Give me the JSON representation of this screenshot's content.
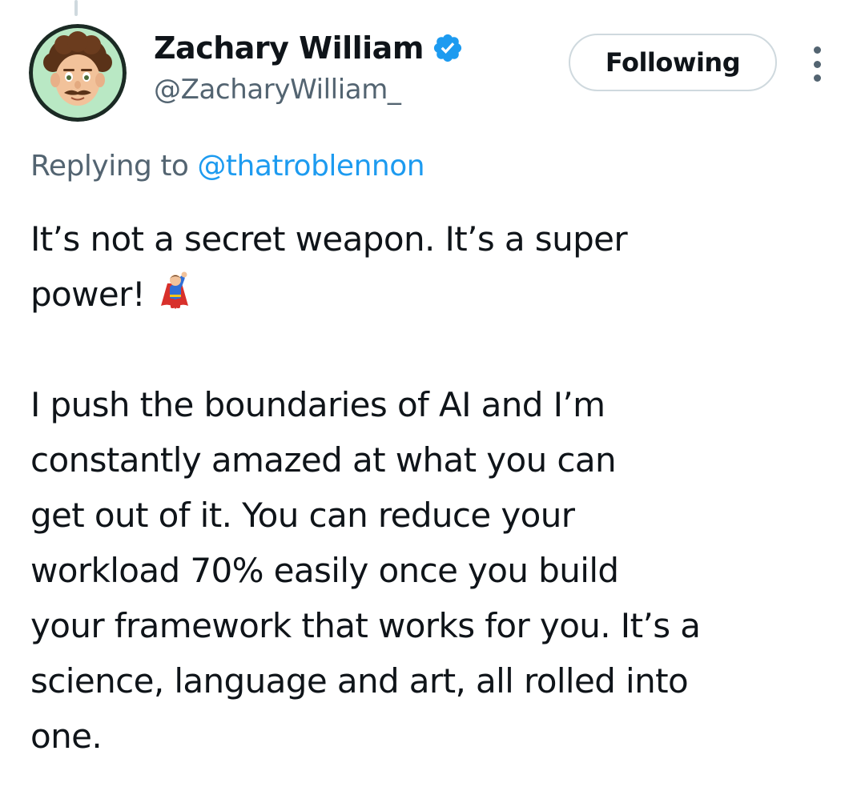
{
  "tweet": {
    "author": {
      "display_name": "Zachary William",
      "handle": "@ZacharyWilliam_",
      "verified": true,
      "avatar_icon": "memoji-avatar"
    },
    "follow_button_label": "Following",
    "more_icon": "more-vertical-icon",
    "replying_prefix": "Replying to",
    "replying_to": "@thatroblennon",
    "paragraph_1": {
      "line_1": "It’s not a secret weapon. It’s a super",
      "line_2": "power!",
      "emoji": "superhero-emoji"
    },
    "paragraph_2": {
      "line_1": "I push the boundaries of AI and I’m",
      "line_2": "constantly amazed at what you can",
      "line_3": "get out of it. You can reduce your",
      "line_4": "workload 70% easily once you build",
      "line_5": "your framework that works for you. It’s a",
      "line_6": "science, language and art, all rolled into",
      "line_7": "one."
    }
  },
  "colors": {
    "text_primary": "#0f1419",
    "text_secondary": "#536471",
    "link": "#1d9bf0",
    "border": "#cfd9de",
    "verified": "#1d9bf0"
  }
}
